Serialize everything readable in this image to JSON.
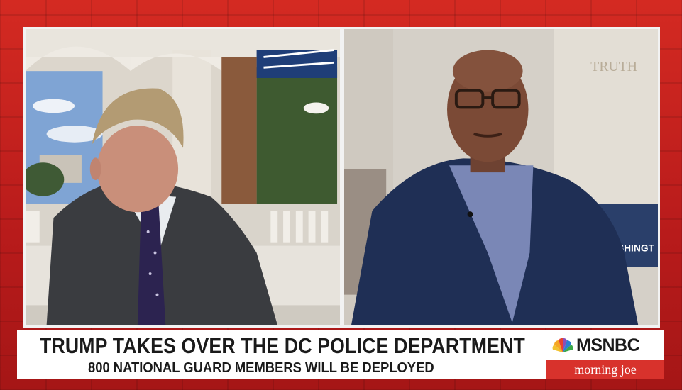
{
  "headline": "TRUMP TAKES OVER THE DC POLICE DEPARTMENT",
  "subheadline": "800 NATIONAL GUARD MEMBERS WILL BE DEPLOYED",
  "network": "MSNBC",
  "show": "morning joe",
  "background_text_right": "TRUTH",
  "sign_text_right": "ASHINGT",
  "icons": {
    "network_logo": "peacock-icon"
  },
  "colors": {
    "frame_red": "#c41f1f",
    "show_tag_red": "#d8322c",
    "lower_third_bg": "#ffffff",
    "text_dark": "#1a1a1a"
  }
}
